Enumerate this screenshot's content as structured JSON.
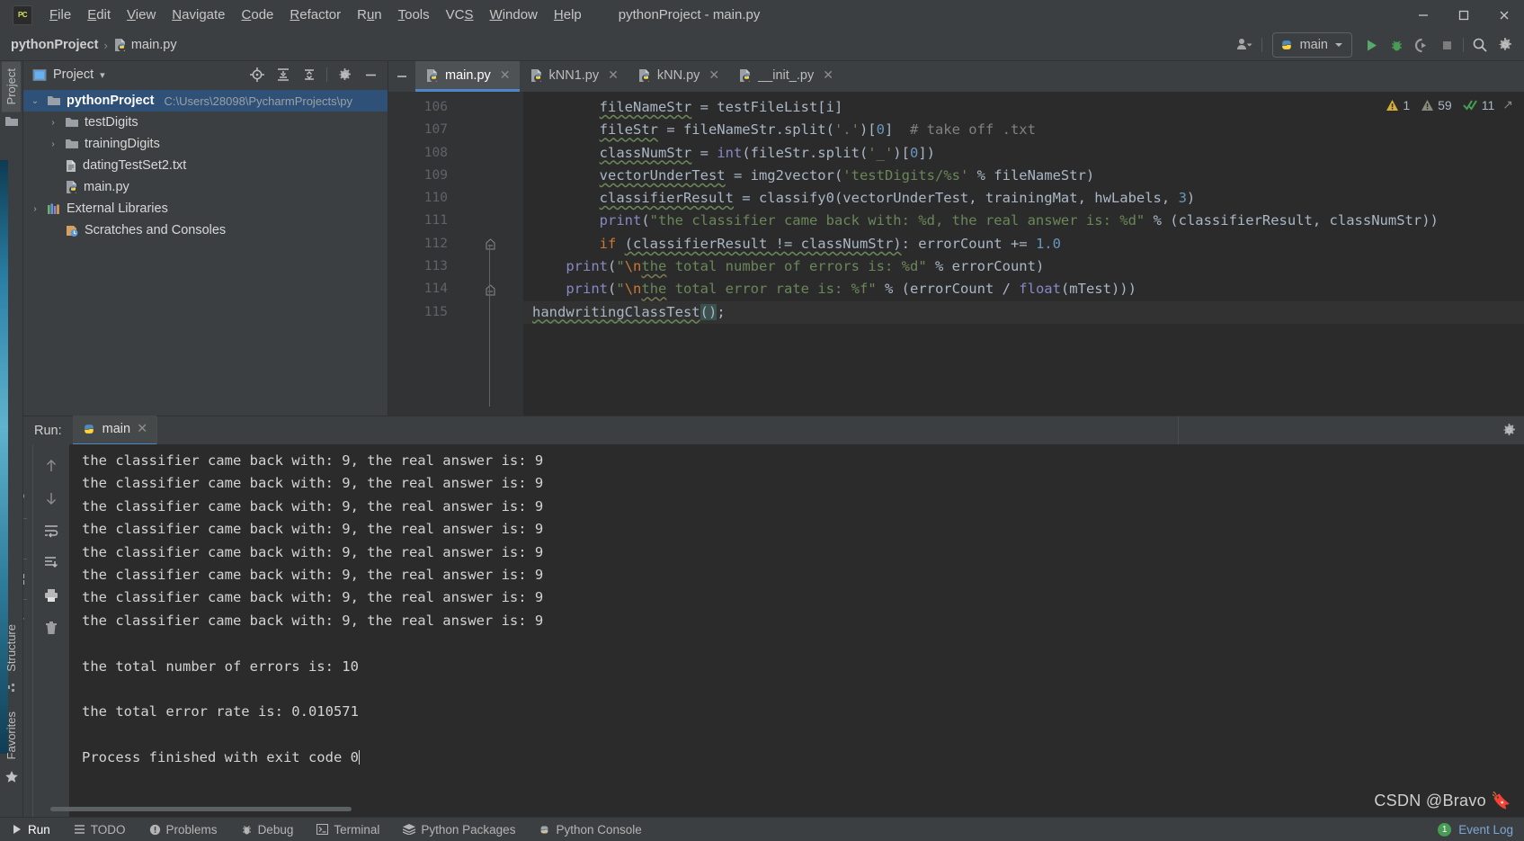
{
  "window": {
    "title": "pythonProject - main.py",
    "app_icon": "pycharm-logo-icon",
    "minimize": "─",
    "maximize": "☐",
    "close": "✕"
  },
  "menubar": {
    "items": [
      {
        "label": "File"
      },
      {
        "label": "Edit"
      },
      {
        "label": "View"
      },
      {
        "label": "Navigate"
      },
      {
        "label": "Code"
      },
      {
        "label": "Refactor"
      },
      {
        "label": "Run"
      },
      {
        "label": "Tools"
      },
      {
        "label": "VCS"
      },
      {
        "label": "Window"
      },
      {
        "label": "Help"
      }
    ]
  },
  "navbar": {
    "breadcrumb_project": "pythonProject",
    "breadcrumb_sep": "›",
    "breadcrumb_file": "main.py",
    "run_config": "main",
    "icons": {
      "user": "user-avatar-icon",
      "run": "run-icon",
      "debug": "debug-icon",
      "coverage": "run-with-coverage-icon",
      "stop": "stop-icon",
      "search": "search-everywhere-icon",
      "settings": "settings-gear-icon"
    }
  },
  "left_rail": {
    "project_tab": "Project",
    "structure_tab": "Structure",
    "favorites_tab": "Favorites"
  },
  "project_pane": {
    "title": "Project",
    "dropdown": "▾",
    "toolbar": [
      "locate-icon",
      "expand-all-icon",
      "collapse-all-icon",
      "settings-gear-icon",
      "hide-icon"
    ],
    "tree": [
      {
        "indent": 0,
        "arrow": "⌄",
        "icon": "folder-icon",
        "name": "pythonProject",
        "bold": true,
        "path": "C:\\Users\\28098\\PycharmProjects\\py",
        "selected": true
      },
      {
        "indent": 1,
        "arrow": "›",
        "icon": "folder-icon",
        "name": "testDigits",
        "bold": false,
        "path": "",
        "selected": false
      },
      {
        "indent": 1,
        "arrow": "›",
        "icon": "folder-icon",
        "name": "trainingDigits",
        "bold": false,
        "path": "",
        "selected": false
      },
      {
        "indent": 1,
        "arrow": "",
        "icon": "text-file-icon",
        "name": "datingTestSet2.txt",
        "bold": false,
        "path": "",
        "selected": false
      },
      {
        "indent": 1,
        "arrow": "",
        "icon": "python-file-icon",
        "name": "main.py",
        "bold": false,
        "path": "",
        "selected": false
      },
      {
        "indent": 0,
        "arrow": "›",
        "icon": "library-icon",
        "name": "External Libraries",
        "bold": false,
        "path": "",
        "selected": false
      },
      {
        "indent": 0,
        "arrow": "",
        "icon": "scratches-icon",
        "name": "Scratches and Consoles",
        "bold": false,
        "path": "",
        "selected": false
      }
    ]
  },
  "editor": {
    "tabs": [
      {
        "label": "main.py",
        "active": true
      },
      {
        "label": "kNN1.py",
        "active": false
      },
      {
        "label": "kNN.py",
        "active": false
      },
      {
        "label": "__init_.py",
        "active": false
      }
    ],
    "line_numbers": [
      "106",
      "107",
      "108",
      "109",
      "110",
      "111",
      "112",
      "113",
      "114",
      "115"
    ],
    "inspections": {
      "warnings": "1",
      "weak_warnings": "59",
      "ok": "11"
    },
    "code_lines": [
      "        fileNameStr = testFileList[i]",
      "        fileStr = fileNameStr.split('.')[0]  # take off .txt",
      "        classNumStr = int(fileStr.split('_')[0])",
      "        vectorUnderTest = img2vector('testDigits/%s' % fileNameStr)",
      "        classifierResult = classify0(vectorUnderTest, trainingMat, hwLabels, 3)",
      "        print(\"the classifier came back with: %d, the real answer is: %d\" % (classifierResult, classNumStr))",
      "        if (classifierResult != classNumStr): errorCount += 1.0",
      "    print(\"\\nthe total number of errors is: %d\" % errorCount)",
      "    print(\"\\nthe total error rate is: %f\" % (errorCount / float(mTest)))",
      "handwritingClassTest();"
    ]
  },
  "run_panel": {
    "label": "Run:",
    "tab": "main",
    "tab_close": "✕",
    "left_toolbar": [
      "run-icon",
      "wrench-icon",
      "stop-icon",
      "layout-icon",
      "pin-icon"
    ],
    "right_toolbar": [
      "arrow-up-icon",
      "arrow-down-icon",
      "soft-wrap-icon",
      "scroll-to-end-icon",
      "print-icon",
      "trash-icon"
    ],
    "settings_icon": "settings-gear-icon",
    "console_lines": [
      "the classifier came back with: 9, the real answer is: 9",
      "the classifier came back with: 9, the real answer is: 9",
      "the classifier came back with: 9, the real answer is: 9",
      "the classifier came back with: 9, the real answer is: 9",
      "the classifier came back with: 9, the real answer is: 9",
      "the classifier came back with: 9, the real answer is: 9",
      "the classifier came back with: 9, the real answer is: 9",
      "the classifier came back with: 9, the real answer is: 9",
      "",
      "the total number of errors is: 10",
      "",
      "the total error rate is: 0.010571",
      "",
      "Process finished with exit code 0"
    ]
  },
  "statusbar": {
    "items": [
      {
        "label": "Run",
        "icon": "run-icon",
        "selected": true
      },
      {
        "label": "TODO",
        "icon": "todo-icon",
        "selected": false
      },
      {
        "label": "Problems",
        "icon": "problems-icon",
        "selected": false
      },
      {
        "label": "Debug",
        "icon": "debug-icon",
        "selected": false
      },
      {
        "label": "Terminal",
        "icon": "terminal-icon",
        "selected": false
      },
      {
        "label": "Python Packages",
        "icon": "packages-icon",
        "selected": false
      },
      {
        "label": "Python Console",
        "icon": "python-console-icon",
        "selected": false
      }
    ],
    "event_log": "Event Log",
    "event_count": "1"
  },
  "watermark": "CSDN @Bravo 🔖",
  "colors": {
    "panel_bg": "#3c3f41",
    "editor_bg": "#2b2b2b",
    "gutter_bg": "#313335",
    "selection_blue": "#2f5177",
    "accent_blue": "#4a88c7",
    "keyword_orange": "#cc7832",
    "string_green": "#6a8759",
    "number_blue": "#6897bb",
    "function_yellow": "#ffc66d",
    "text_default": "#a9b7c6",
    "warning_yellow": "#d6ad3a",
    "ok_green": "#499c54"
  }
}
